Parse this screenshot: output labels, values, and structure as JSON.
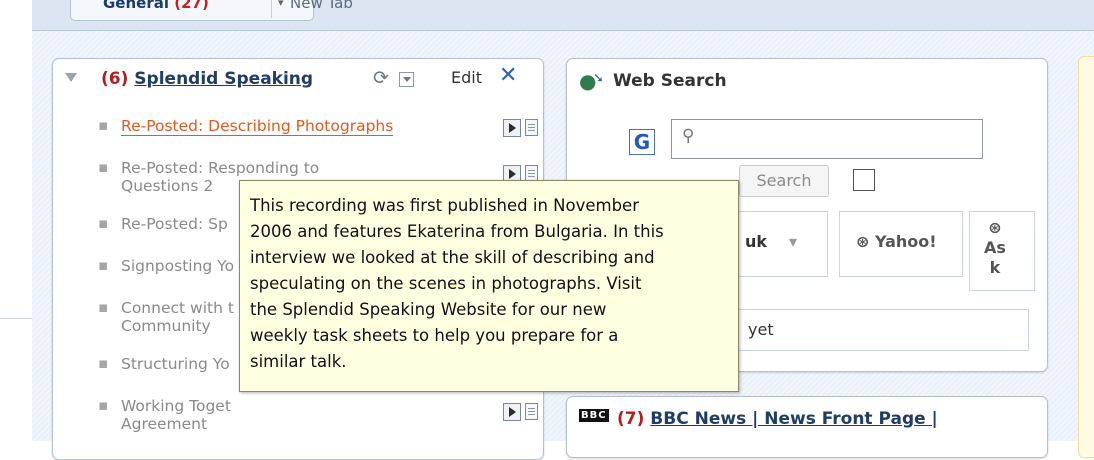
{
  "tabs": [
    {
      "label": "General",
      "count": "(27)",
      "arrow": "▾"
    },
    {
      "label": "New Tab"
    }
  ],
  "splendid": {
    "count": "(6)",
    "title": "Splendid Speaking",
    "edit_label": "Edit",
    "items": [
      {
        "line1": "Re-Posted: Describing Photographs",
        "line2": ""
      },
      {
        "line1": "Re-Posted: Responding to",
        "line2": "Questions 2"
      },
      {
        "line1": "Re-Posted: Sp",
        "line2": ""
      },
      {
        "line1": "Signposting Yo",
        "line2": ""
      },
      {
        "line1": "Connect with t",
        "line2": "Community"
      },
      {
        "line1": "Structuring Yo",
        "line2": ""
      },
      {
        "line1": "Working Toget",
        "line2": "Agreement"
      }
    ],
    "tooltip_lines": [
      "This recording was first published in November",
      "2006 and features Ekaterina from Bulgaria. In this",
      "interview we looked at the skill of describing and",
      "speculating on the scenes in photographs. Visit",
      "the Splendid Speaking Website for our new",
      "weekly task sheets to help you prepare for a",
      "similar talk."
    ]
  },
  "websearch": {
    "title": "Web Search",
    "google_letter": "G",
    "search_button": "Search",
    "engines": {
      "uk": "uk",
      "uk_dropdown": "▾",
      "yahoo": "Yahoo!",
      "ask_line1": "As",
      "ask_line2": "k"
    },
    "results_text": "yet"
  },
  "bbc": {
    "badge": "BBC",
    "count": "(7)",
    "title": "BBC News | News Front Page |"
  }
}
